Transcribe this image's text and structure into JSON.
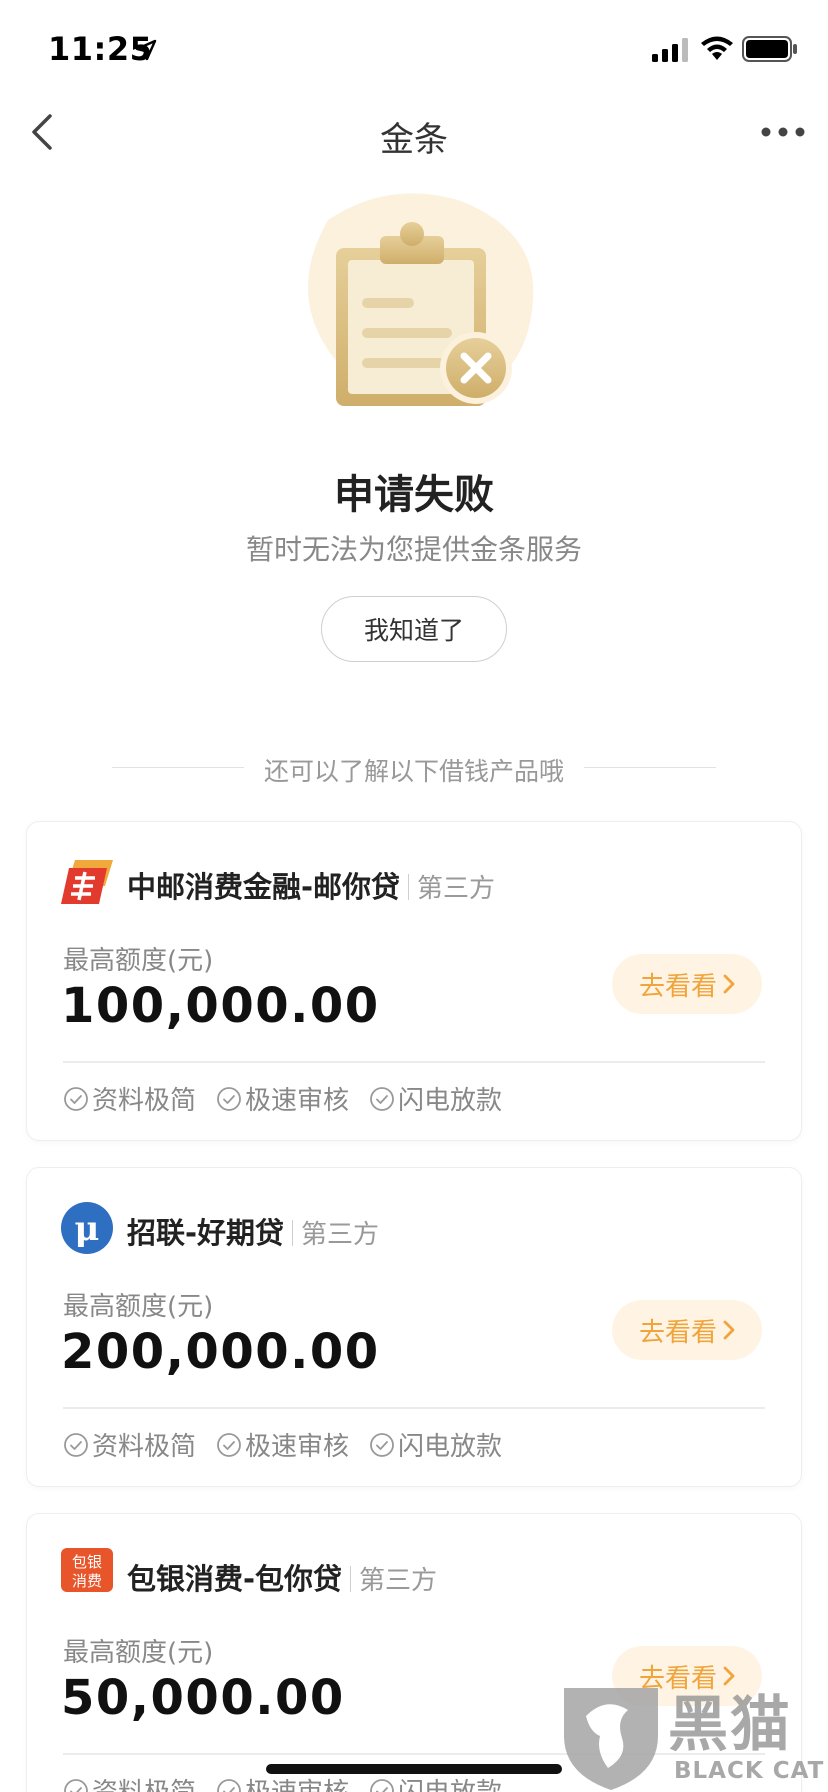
{
  "status_bar": {
    "time": "11:25"
  },
  "nav": {
    "title": "金条"
  },
  "result": {
    "title": "申请失败",
    "subtitle": "暂时无法为您提供金条服务",
    "button_label": "我知道了"
  },
  "section": {
    "label": "还可以了解以下借钱产品哦"
  },
  "products": [
    {
      "name": "中邮消费金融-邮你贷",
      "tag": "第三方",
      "limit_label": "最高额度(元)",
      "limit_value": "100,000.00",
      "button_label": "去看看",
      "features": [
        "资料极简",
        "极速审核",
        "闪电放款"
      ]
    },
    {
      "name": "招联-好期贷",
      "tag": "第三方",
      "limit_label": "最高额度(元)",
      "limit_value": "200,000.00",
      "button_label": "去看看",
      "features": [
        "资料极简",
        "极速审核",
        "闪电放款"
      ]
    },
    {
      "name": "包银消费-包你贷",
      "tag": "第三方",
      "limit_label": "最高额度(元)",
      "limit_value": "50,000.00",
      "button_label": "去看看",
      "features": [
        "资料极简",
        "极速审核",
        "闪电放款"
      ],
      "logo_text": [
        "包银",
        "消费"
      ]
    }
  ],
  "watermark": {
    "text_cn": "黑猫",
    "text_en": "BLACK CAT"
  },
  "colors": {
    "accent": "#f0a43c",
    "accent_bg": "#fff4e3",
    "illustration_gold": "#d9bf85",
    "zhongyou_red": "#e23b2e",
    "zhaolian_blue": "#2f6fc1",
    "baoyin_orange": "#e8552a"
  }
}
